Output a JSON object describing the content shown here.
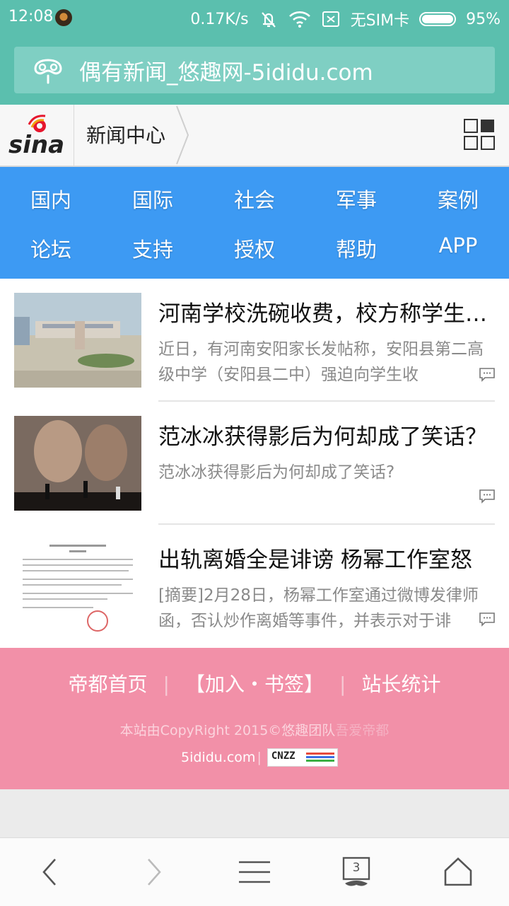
{
  "status_bar": {
    "time": "12:08",
    "network_speed": "0.17K/s",
    "sim_status": "无SIM卡",
    "battery": "95%"
  },
  "browser": {
    "address_text": "偶有新闻_悠趣网-5ididu.com",
    "tab_count": "3"
  },
  "header": {
    "logo_text": "sina",
    "breadcrumb": "新闻中心"
  },
  "nav": {
    "items": [
      {
        "label": "国内"
      },
      {
        "label": "国际"
      },
      {
        "label": "社会"
      },
      {
        "label": "军事"
      },
      {
        "label": "案例"
      },
      {
        "label": "论坛"
      },
      {
        "label": "支持"
      },
      {
        "label": "授权"
      },
      {
        "label": "帮助"
      },
      {
        "label": "APP"
      }
    ]
  },
  "news": [
    {
      "title": "河南学校洗碗收费，校方称学生自愿",
      "summary": "近日，有河南安阳家长发帖称，安阳县第二高级中学（安阳县二中）强迫向学生收"
    },
    {
      "title": "范冰冰获得影后为何却成了笑话？",
      "summary": "范冰冰获得影后为何却成了笑话?"
    },
    {
      "title": "出轨离婚全是诽谤  杨幂工作室怒",
      "summary": "[摘要]2月28日，杨幂工作室通过微博发律师函，否认炒作离婚等事件，并表示对于诽"
    }
  ],
  "footer": {
    "links": [
      "帝都首页",
      "【加入・书签】",
      "站长统计"
    ],
    "copyright_a": "本站由CopyRight  2015©悠趣团队",
    "copyright_b": "吾爱帝都",
    "site": "5ididu.com",
    "badge": "CNZZ"
  },
  "colors": {
    "status_bg": "#5bbfae",
    "nav_bg": "#3d9af3",
    "footer_bg": "#f290a8"
  }
}
